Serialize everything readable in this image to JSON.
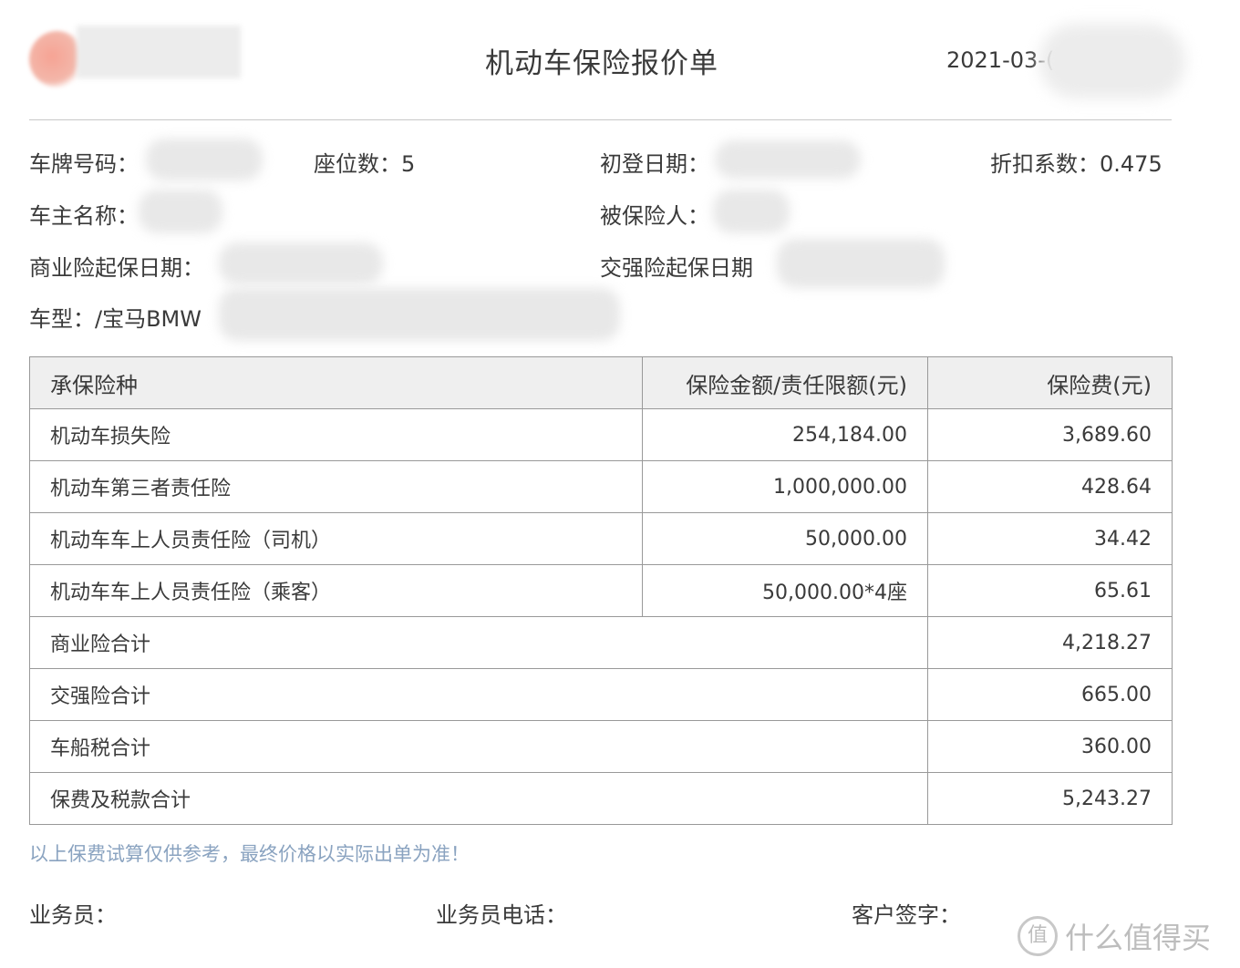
{
  "header": {
    "title": "机动车保险报价单",
    "date": "2021-03-("
  },
  "info": {
    "plate_label": "车牌号码：",
    "seats_label": "座位数：",
    "seats_value": "5",
    "reg_date_label": "初登日期：",
    "discount_label": "折扣系数：",
    "discount_value": "0.475",
    "owner_label": "车主名称：",
    "insured_label": "被保险人：",
    "commercial_start_label": "商业险起保日期：",
    "compulsory_start_label": "交强险起保日期",
    "model_label": "车型：",
    "model_value": "/宝马BMW"
  },
  "table": {
    "headers": [
      "承保险种",
      "保险金额/责任限额(元)",
      "保险费(元)"
    ],
    "rows": [
      {
        "name": "机动车损失险",
        "amount": "254,184.00",
        "premium": "3,689.60"
      },
      {
        "name": "机动车第三者责任险",
        "amount": "1,000,000.00",
        "premium": "428.64"
      },
      {
        "name": "机动车车上人员责任险（司机）",
        "amount": "50,000.00",
        "premium": "34.42"
      },
      {
        "name": "机动车车上人员责任险（乘客）",
        "amount": "50,000.00*4座",
        "premium": "65.61"
      }
    ],
    "totals": [
      {
        "name": "商业险合计",
        "premium": "4,218.27"
      },
      {
        "name": "交强险合计",
        "premium": "665.00"
      },
      {
        "name": "车船税合计",
        "premium": "360.00"
      },
      {
        "name": "保费及税款合计",
        "premium": "5,243.27"
      }
    ]
  },
  "note": "以上保费试算仅供参考，最终价格以实际出单为准！",
  "footer": {
    "agent_label": "业务员：",
    "agent_phone_label": "业务员电话：",
    "signature_label": "客户签字："
  },
  "watermark": {
    "badge": "值",
    "text": "什么值得买"
  }
}
